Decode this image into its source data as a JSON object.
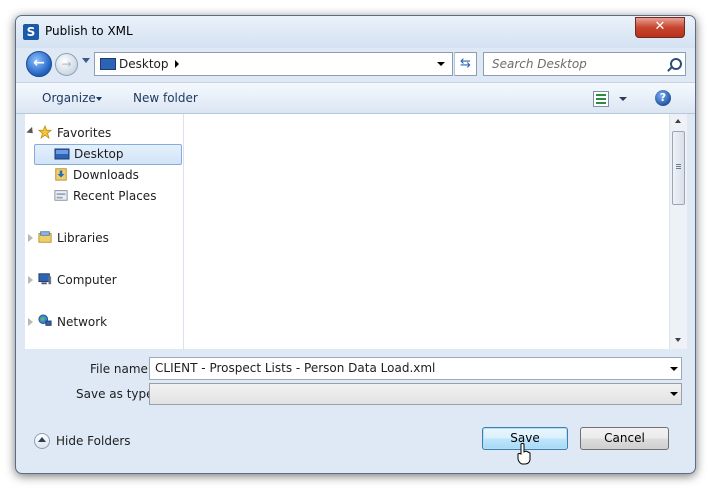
{
  "window": {
    "title": "Publish to XML",
    "close_glyph": "✕",
    "app_icon_letter": "S"
  },
  "address": {
    "location": "Desktop",
    "search_placeholder": "Search Desktop"
  },
  "toolbar": {
    "organize": "Organize",
    "new_folder": "New folder",
    "help": "?"
  },
  "nav": {
    "favorites": "Favorites",
    "desktop": "Desktop",
    "downloads": "Downloads",
    "recent_places": "Recent Places",
    "libraries": "Libraries",
    "computer": "Computer",
    "network": "Network"
  },
  "form": {
    "file_name_label": "File name:",
    "file_name_value": "CLIENT - Prospect Lists - Person Data Load.xml",
    "save_as_type_label": "Save as type:",
    "save_as_type_value": ""
  },
  "footer": {
    "hide_folders": "Hide Folders",
    "save": "Save",
    "cancel": "Cancel"
  },
  "colors": {
    "accent": "#1e5fc0",
    "close": "#c7452f",
    "selection": "#84acdd"
  }
}
